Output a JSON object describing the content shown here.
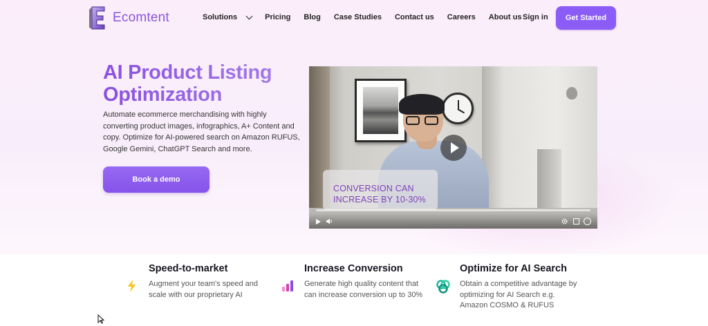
{
  "brand": {
    "name": "Ecomtent",
    "accent": "#8b5cf6"
  },
  "nav": {
    "items": [
      {
        "label": "Solutions",
        "has_dropdown": true,
        "icon": "chevron-down-icon"
      },
      {
        "label": "Pricing"
      },
      {
        "label": "Blog"
      },
      {
        "label": "Case Studies"
      },
      {
        "label": "Contact us"
      },
      {
        "label": "Careers"
      },
      {
        "label": "About us"
      }
    ],
    "signin_label": "Sign in",
    "cta_label": "Get Started"
  },
  "hero": {
    "title": "AI Product Listing Optimization",
    "description": "Automate ecommerce merchandising with highly converting product images, infographics, A+ Content and copy. Optimize for AI-powered search on Amazon RUFUS, Google Gemini, ChatGPT Search and more.",
    "button_label": "Book a demo"
  },
  "video": {
    "overlay_text": "CONVERSION CAN INCREASE BY 10-30%",
    "controls": [
      "play-icon",
      "volume-icon",
      "settings-icon",
      "fullscreen-icon",
      "captions-icon"
    ]
  },
  "features": [
    {
      "title": "Speed-to-market",
      "description": "Augment your team's speed and scale with our proprietary AI",
      "icon": "lightning-icon",
      "color": "#f5c518"
    },
    {
      "title": "Increase Conversion",
      "description": "Generate high quality content that can increase conversion up to 30%",
      "icon": "bar-chart-icon",
      "color": "#e040a0"
    },
    {
      "title": "Optimize for AI Search",
      "description": "Obtain a competitive advantage by optimizing for AI Search e.g. Amazon COSMO & RUFUS",
      "icon": "ai-knot-icon",
      "color": "#20b2a0"
    }
  ]
}
